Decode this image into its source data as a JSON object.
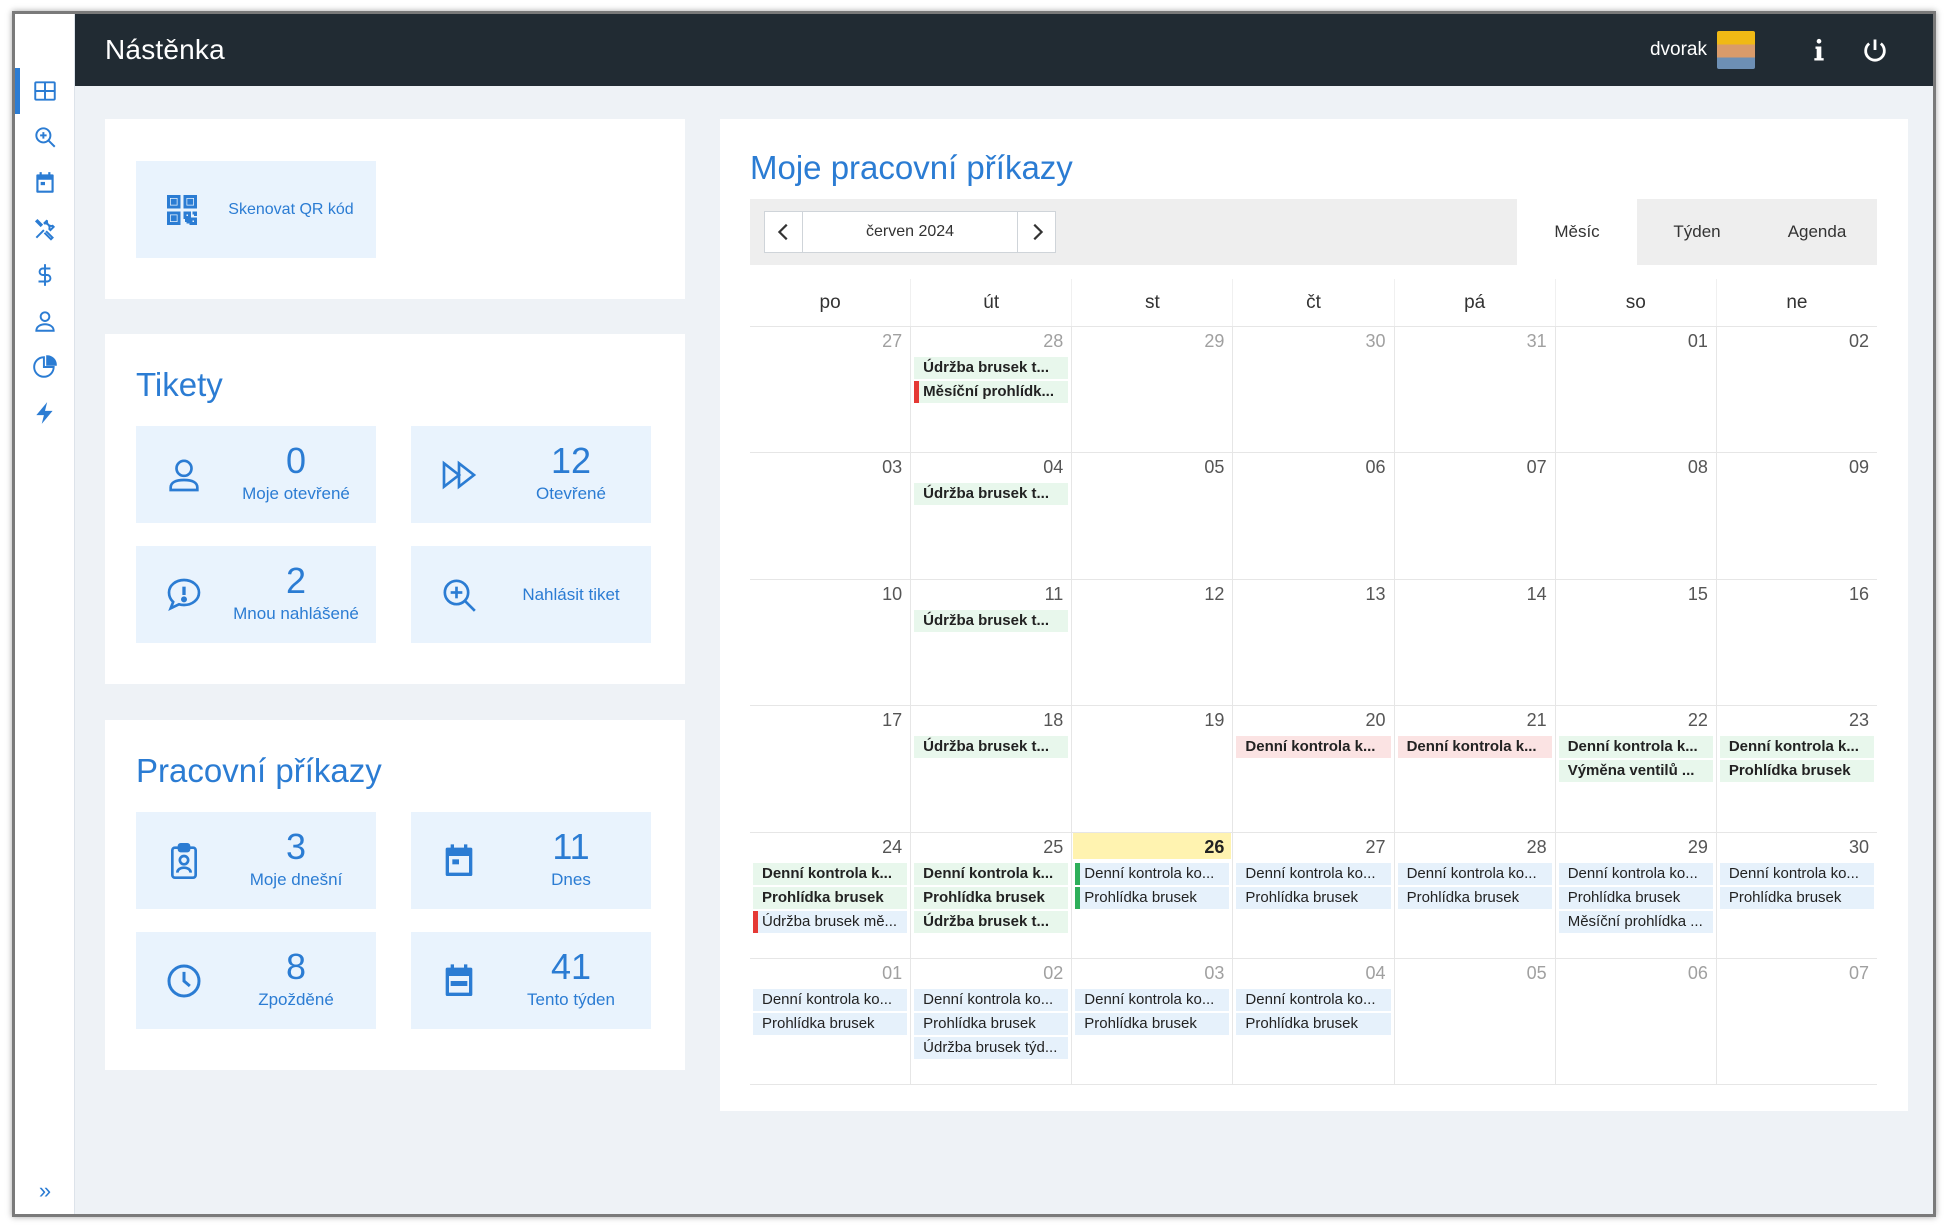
{
  "app": {
    "title": "Nástěnka",
    "user": "dvorak"
  },
  "rail": {
    "items": [
      "dashboard-icon",
      "zoom-in-icon",
      "calendar-icon",
      "tools-icon",
      "dollar-icon",
      "user-icon",
      "pie-chart-icon",
      "bolt-icon"
    ],
    "expand": "»"
  },
  "scan": {
    "label": "Skenovat QR kód"
  },
  "tickets": {
    "title": "Tikety",
    "my_open": {
      "value": "0",
      "label": "Moje otevřené"
    },
    "open": {
      "value": "12",
      "label": "Otevřené"
    },
    "reported": {
      "value": "2",
      "label": "Mnou nahlášené"
    },
    "report": {
      "label": "Nahlásit tiket"
    }
  },
  "work_orders": {
    "title": "Pracovní příkazy",
    "my_today": {
      "value": "3",
      "label": "Moje dnešní"
    },
    "today": {
      "value": "11",
      "label": "Dnes"
    },
    "late": {
      "value": "8",
      "label": "Zpožděné"
    },
    "week": {
      "value": "41",
      "label": "Tento týden"
    }
  },
  "calendar": {
    "title": "Moje pracovní příkazy",
    "month": "červen 2024",
    "prev": "‹",
    "next": "›",
    "views": [
      "Měsíc",
      "Týden",
      "Agenda"
    ],
    "active_view": "Měsíc",
    "weekdays": [
      "po",
      "út",
      "st",
      "čt",
      "pá",
      "so",
      "ne"
    ],
    "weeks": [
      [
        {
          "day": "27",
          "other": true,
          "events": []
        },
        {
          "day": "28",
          "other": true,
          "events": [
            {
              "text": "Údržba brusek t...",
              "style": "green bold"
            },
            {
              "text": "Měsíční prohlídk...",
              "style": "green bold mark-red"
            }
          ]
        },
        {
          "day": "29",
          "other": true,
          "events": []
        },
        {
          "day": "30",
          "other": true,
          "events": []
        },
        {
          "day": "31",
          "other": true,
          "events": []
        },
        {
          "day": "01",
          "events": []
        },
        {
          "day": "02",
          "events": []
        }
      ],
      [
        {
          "day": "03",
          "events": []
        },
        {
          "day": "04",
          "events": [
            {
              "text": "Údržba brusek t...",
              "style": "green bold"
            }
          ]
        },
        {
          "day": "05",
          "events": []
        },
        {
          "day": "06",
          "events": []
        },
        {
          "day": "07",
          "events": []
        },
        {
          "day": "08",
          "events": []
        },
        {
          "day": "09",
          "events": []
        }
      ],
      [
        {
          "day": "10",
          "events": []
        },
        {
          "day": "11",
          "events": [
            {
              "text": "Údržba brusek t...",
              "style": "green bold"
            }
          ]
        },
        {
          "day": "12",
          "events": []
        },
        {
          "day": "13",
          "events": []
        },
        {
          "day": "14",
          "events": []
        },
        {
          "day": "15",
          "events": []
        },
        {
          "day": "16",
          "events": []
        }
      ],
      [
        {
          "day": "17",
          "events": []
        },
        {
          "day": "18",
          "events": [
            {
              "text": "Údržba brusek t...",
              "style": "green bold"
            }
          ]
        },
        {
          "day": "19",
          "events": []
        },
        {
          "day": "20",
          "events": [
            {
              "text": "Denní kontrola k...",
              "style": "pink bold"
            }
          ]
        },
        {
          "day": "21",
          "events": [
            {
              "text": "Denní kontrola k...",
              "style": "pink bold"
            }
          ]
        },
        {
          "day": "22",
          "events": [
            {
              "text": "Denní kontrola k...",
              "style": "green bold"
            },
            {
              "text": "Výměna ventilů ...",
              "style": "green bold"
            }
          ]
        },
        {
          "day": "23",
          "events": [
            {
              "text": "Denní kontrola k...",
              "style": "green bold"
            },
            {
              "text": "Prohlídka brusek",
              "style": "green bold"
            }
          ]
        }
      ],
      [
        {
          "day": "24",
          "events": [
            {
              "text": "Denní kontrola k...",
              "style": "green bold"
            },
            {
              "text": "Prohlídka brusek",
              "style": "green bold"
            },
            {
              "text": "Údržba brusek mě...",
              "style": "blue mark-red"
            }
          ]
        },
        {
          "day": "25",
          "events": [
            {
              "text": "Denní kontrola k...",
              "style": "green bold"
            },
            {
              "text": "Prohlídka brusek",
              "style": "green bold"
            },
            {
              "text": "Údržba brusek t...",
              "style": "green bold"
            }
          ]
        },
        {
          "day": "26",
          "today": true,
          "events": [
            {
              "text": "Denní kontrola ko...",
              "style": "blue mark-green"
            },
            {
              "text": "Prohlídka brusek",
              "style": "blue mark-green"
            }
          ]
        },
        {
          "day": "27",
          "events": [
            {
              "text": "Denní kontrola ko...",
              "style": "blue"
            },
            {
              "text": "Prohlídka brusek",
              "style": "blue"
            }
          ]
        },
        {
          "day": "28",
          "events": [
            {
              "text": "Denní kontrola ko...",
              "style": "blue"
            },
            {
              "text": "Prohlídka brusek",
              "style": "blue"
            }
          ]
        },
        {
          "day": "29",
          "events": [
            {
              "text": "Denní kontrola ko...",
              "style": "blue"
            },
            {
              "text": "Prohlídka brusek",
              "style": "blue"
            },
            {
              "text": "Měsíční prohlídka ...",
              "style": "blue"
            }
          ]
        },
        {
          "day": "30",
          "events": [
            {
              "text": "Denní kontrola ko...",
              "style": "blue"
            },
            {
              "text": "Prohlídka brusek",
              "style": "blue"
            }
          ]
        }
      ],
      [
        {
          "day": "01",
          "other": true,
          "events": [
            {
              "text": "Denní kontrola ko...",
              "style": "blue"
            },
            {
              "text": "Prohlídka brusek",
              "style": "blue"
            }
          ]
        },
        {
          "day": "02",
          "other": true,
          "events": [
            {
              "text": "Denní kontrola ko...",
              "style": "blue"
            },
            {
              "text": "Prohlídka brusek",
              "style": "blue"
            },
            {
              "text": "Údržba brusek týd...",
              "style": "blue"
            }
          ]
        },
        {
          "day": "03",
          "other": true,
          "events": [
            {
              "text": "Denní kontrola ko...",
              "style": "blue"
            },
            {
              "text": "Prohlídka brusek",
              "style": "blue"
            }
          ]
        },
        {
          "day": "04",
          "other": true,
          "events": [
            {
              "text": "Denní kontrola ko...",
              "style": "blue"
            },
            {
              "text": "Prohlídka brusek",
              "style": "blue"
            }
          ]
        },
        {
          "day": "05",
          "other": true,
          "events": []
        },
        {
          "day": "06",
          "other": true,
          "events": []
        },
        {
          "day": "07",
          "other": true,
          "events": []
        }
      ]
    ]
  },
  "colors": {
    "accent": "#2b7cd3",
    "topbar": "#212b33",
    "tile": "#e9f3fd",
    "today": "#fff3b0"
  }
}
